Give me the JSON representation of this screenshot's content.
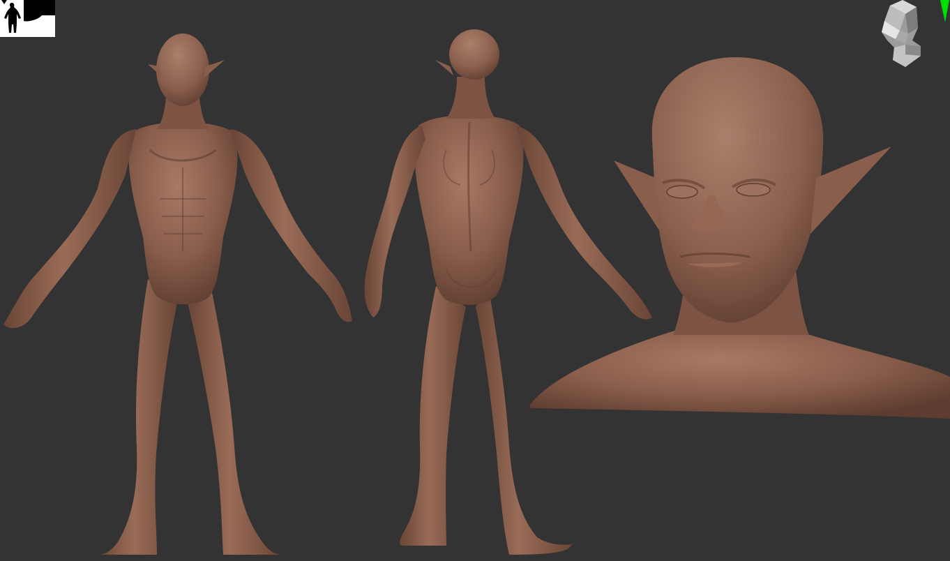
{
  "viewport": {
    "background_color": "#333333",
    "mesh_color": "#8a5e4c",
    "mesh_highlight": "#a67866",
    "mesh_shadow": "#5a3a2e"
  },
  "overlays": {
    "thumbnail": {
      "icon": "silhouette-thumbnail-icon"
    },
    "navigation": {
      "icon": "head-navigation-cube-icon"
    },
    "axis": {
      "icon": "green-axis-marker-icon",
      "color": "#00e000"
    }
  }
}
